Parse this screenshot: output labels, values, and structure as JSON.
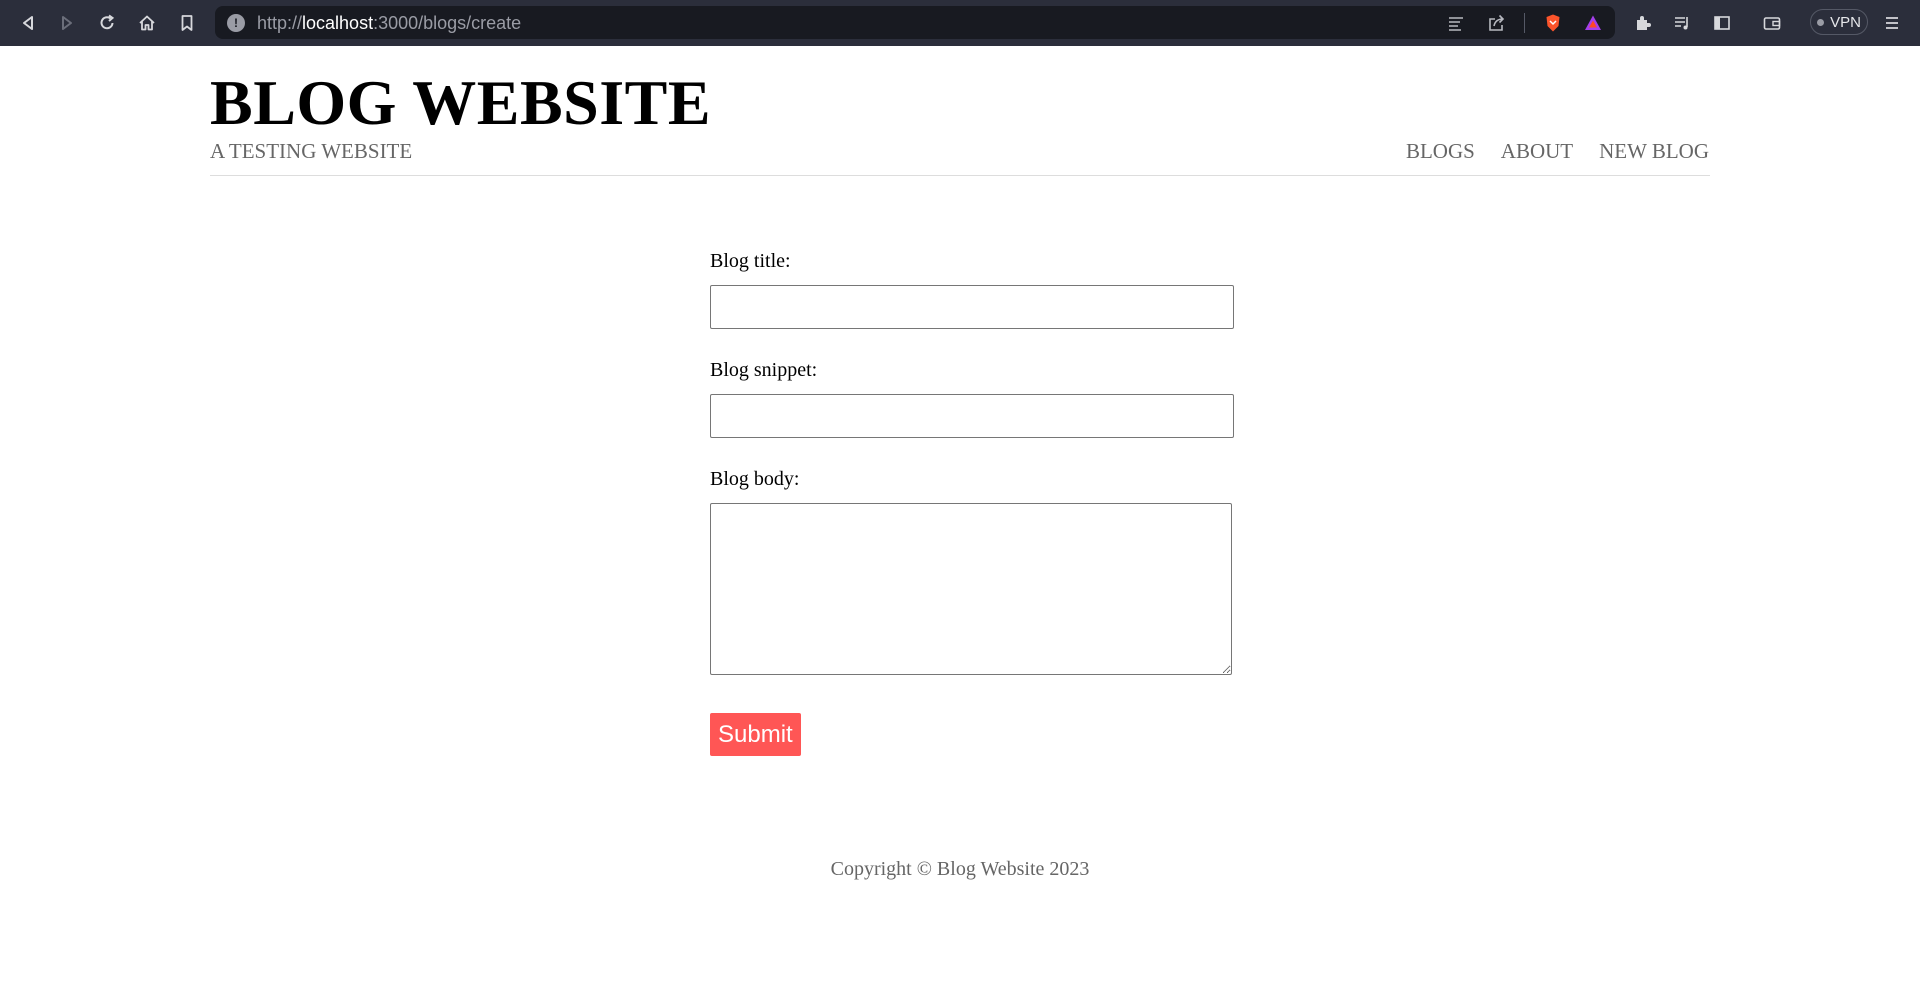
{
  "browser": {
    "url_scheme": "http://",
    "url_host": "localhost",
    "url_path": ":3000/blogs/create",
    "vpn_label": "VPN",
    "icons": [
      "back-icon",
      "forward-icon",
      "reload-icon",
      "home-icon",
      "bookmark-icon",
      "site-info-icon",
      "reader-mode-icon",
      "share-icon",
      "brave-shields-icon",
      "brave-rewards-icon",
      "extensions-icon",
      "playlist-icon",
      "sidebar-icon",
      "wallet-icon",
      "menu-icon"
    ]
  },
  "header": {
    "title": "BLOG WEBSITE",
    "subtitle": "A TESTING WEBSITE",
    "nav": [
      "BLOGS",
      "ABOUT",
      "NEW BLOG"
    ]
  },
  "form": {
    "title_label": "Blog title:",
    "title_value": "",
    "snippet_label": "Blog snippet:",
    "snippet_value": "",
    "body_label": "Blog body:",
    "body_value": "",
    "submit_label": "Submit",
    "submit_color": "#ff5655"
  },
  "footer": {
    "text": "Copyright © Blog Website 2023"
  }
}
